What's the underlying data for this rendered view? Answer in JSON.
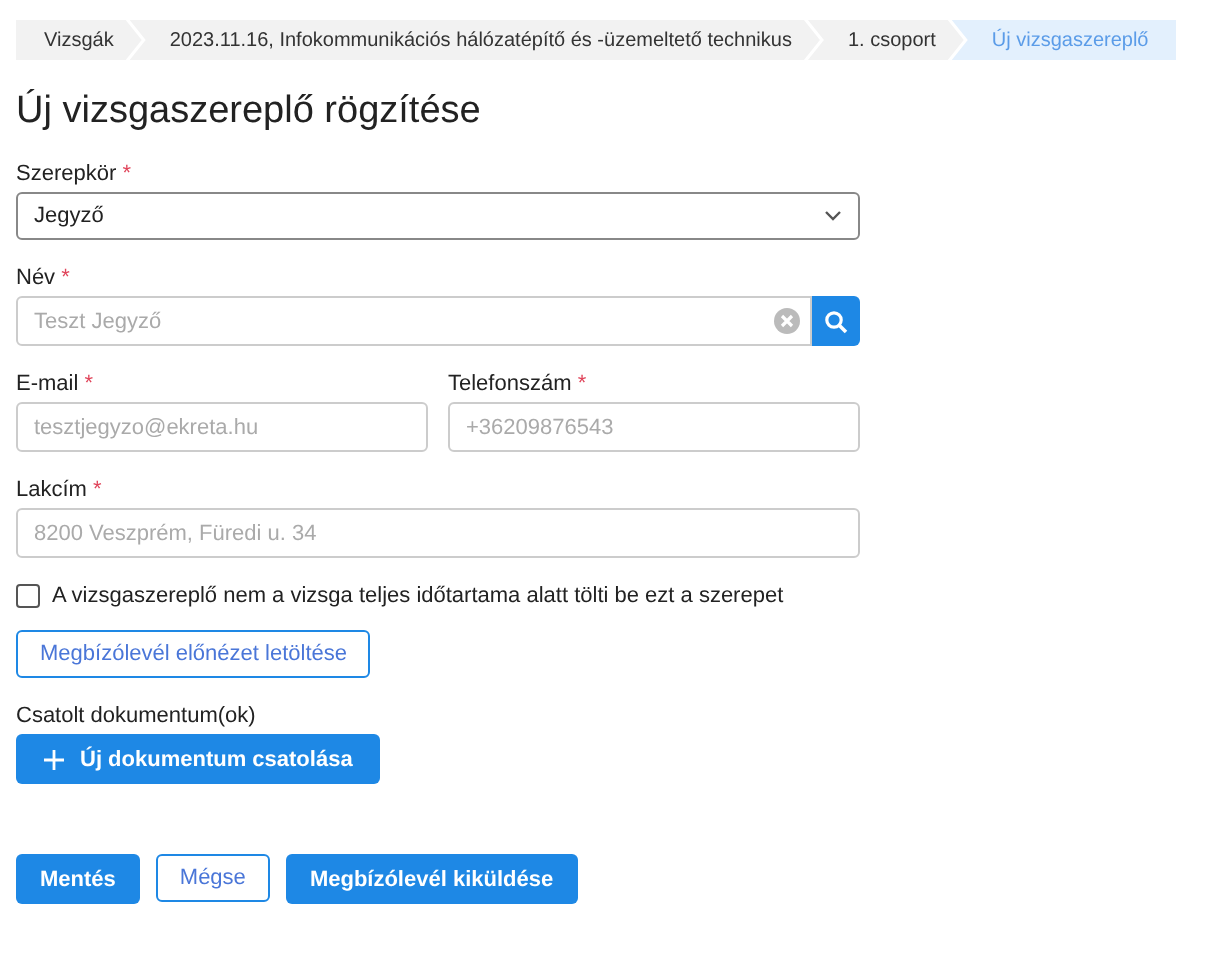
{
  "breadcrumb": [
    {
      "label": "Vizsgák",
      "selected": false
    },
    {
      "label": "2023.11.16, Infokommunikációs hálózatépítő és -üzemeltető technikus",
      "selected": false
    },
    {
      "label": "1. csoport",
      "selected": false
    },
    {
      "label": "Új vizsgaszereplő",
      "selected": true
    }
  ],
  "title": "Új vizsgaszereplő rögzítése",
  "role": {
    "label": "Szerepkör",
    "required_mark": "*",
    "value": "Jegyző"
  },
  "name": {
    "label": "Név",
    "required_mark": "*",
    "placeholder": "Teszt Jegyző"
  },
  "email": {
    "label": "E-mail",
    "required_mark": "*",
    "placeholder": "tesztjegyzo@ekreta.hu"
  },
  "phone": {
    "label": "Telefonszám",
    "required_mark": "*",
    "placeholder": "+36209876543"
  },
  "address": {
    "label": "Lakcím",
    "required_mark": "*",
    "placeholder": "8200 Veszprém, Füredi u. 34"
  },
  "partial_checkbox": {
    "label": "A vizsgaszereplő nem a vizsga teljes időtartama alatt tölti be ezt a szerepet",
    "checked": false
  },
  "preview_button": "Megbízólevél előnézet letöltése",
  "attachments": {
    "label": "Csatolt dokumentum(ok)",
    "add_button": "Új dokumentum csatolása"
  },
  "actions": [
    {
      "label": "Mentés",
      "kind": "primary"
    },
    {
      "label": "Mégse",
      "kind": "outline"
    },
    {
      "label": "Megbízólevél kiküldése",
      "kind": "primary"
    }
  ]
}
